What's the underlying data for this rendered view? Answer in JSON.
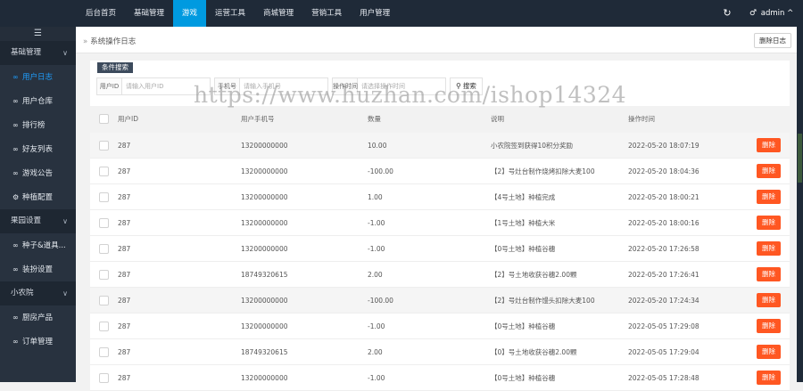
{
  "nav": {
    "items": [
      "后台首页",
      "基础管理",
      "游戏",
      "运营工具",
      "商城管理",
      "营销工具",
      "用户管理"
    ],
    "active_index": 2,
    "refresh_icon": "refresh-icon",
    "user_icon": "user-icon",
    "user_label": "admin",
    "user_chevron": "^"
  },
  "sidebar": {
    "toggle": "☰",
    "entries": [
      {
        "kind": "group",
        "label": "基础管理"
      },
      {
        "kind": "item",
        "label": "用户日志",
        "icon": "link-icon",
        "active": true
      },
      {
        "kind": "item",
        "label": "用户仓库",
        "icon": "link-icon"
      },
      {
        "kind": "item",
        "label": "排行榜",
        "icon": "link-icon"
      },
      {
        "kind": "item",
        "label": "好友列表",
        "icon": "link-icon"
      },
      {
        "kind": "item",
        "label": "游戏公告",
        "icon": "link-icon"
      },
      {
        "kind": "item",
        "label": "种植配置",
        "icon": "gear-icon"
      },
      {
        "kind": "group",
        "label": "果园设置"
      },
      {
        "kind": "item",
        "label": "种子&道具...",
        "icon": "link-icon"
      },
      {
        "kind": "item",
        "label": "装扮设置",
        "icon": "link-icon"
      },
      {
        "kind": "group",
        "label": "小农院"
      },
      {
        "kind": "item",
        "label": "厨房产品",
        "icon": "link-icon"
      },
      {
        "kind": "item",
        "label": "订单管理",
        "icon": "link-icon"
      }
    ]
  },
  "breadcrumb": {
    "text": "系统操作日志"
  },
  "clear_button": "删除日志",
  "search": {
    "title": "条件搜索",
    "fields": [
      {
        "label": "用户ID",
        "placeholder": "请输入用户ID"
      },
      {
        "label": "手机号",
        "placeholder": "请输入手机号"
      },
      {
        "label": "操作时间",
        "placeholder": "请选择操作时间"
      }
    ],
    "button": "搜索"
  },
  "table": {
    "columns": [
      "用户ID",
      "用户手机号",
      "数量",
      "说明",
      "操作时间"
    ],
    "delete_label": "删除",
    "rows": [
      {
        "uid": "287",
        "phone": "13200000000",
        "amount": "10.00",
        "desc": "小农院签到获得10积分奖励",
        "time": "2022-05-20 18:07:19"
      },
      {
        "uid": "287",
        "phone": "13200000000",
        "amount": "-100.00",
        "desc": "【2】号灶台制作烧烤扣除大麦100",
        "time": "2022-05-20 18:04:36"
      },
      {
        "uid": "287",
        "phone": "13200000000",
        "amount": "1.00",
        "desc": "【4号土地】种植完成",
        "time": "2022-05-20 18:00:21"
      },
      {
        "uid": "287",
        "phone": "13200000000",
        "amount": "-1.00",
        "desc": "【1号土地】种植大米",
        "time": "2022-05-20 18:00:16"
      },
      {
        "uid": "287",
        "phone": "13200000000",
        "amount": "-1.00",
        "desc": "【0号土地】种植谷穗",
        "time": "2022-05-20 17:26:58"
      },
      {
        "uid": "287",
        "phone": "18749320615",
        "amount": "2.00",
        "desc": "【2】号土地收获谷穗2.00颗",
        "time": "2022-05-20 17:26:41"
      },
      {
        "uid": "287",
        "phone": "13200000000",
        "amount": "-100.00",
        "desc": "【2】号灶台制作馒头扣除大麦100",
        "time": "2022-05-20 17:24:34"
      },
      {
        "uid": "287",
        "phone": "13200000000",
        "amount": "-1.00",
        "desc": "【0号土地】种植谷穗",
        "time": "2022-05-05 17:29:08"
      },
      {
        "uid": "287",
        "phone": "18749320615",
        "amount": "2.00",
        "desc": "【0】号土地收获谷穗2.00颗",
        "time": "2022-05-05 17:29:04"
      },
      {
        "uid": "287",
        "phone": "13200000000",
        "amount": "-1.00",
        "desc": "【0号土地】种植谷穗",
        "time": "2022-05-05 17:28:48"
      }
    ]
  },
  "watermark": "https://www.huzhan.com/ishop14324"
}
